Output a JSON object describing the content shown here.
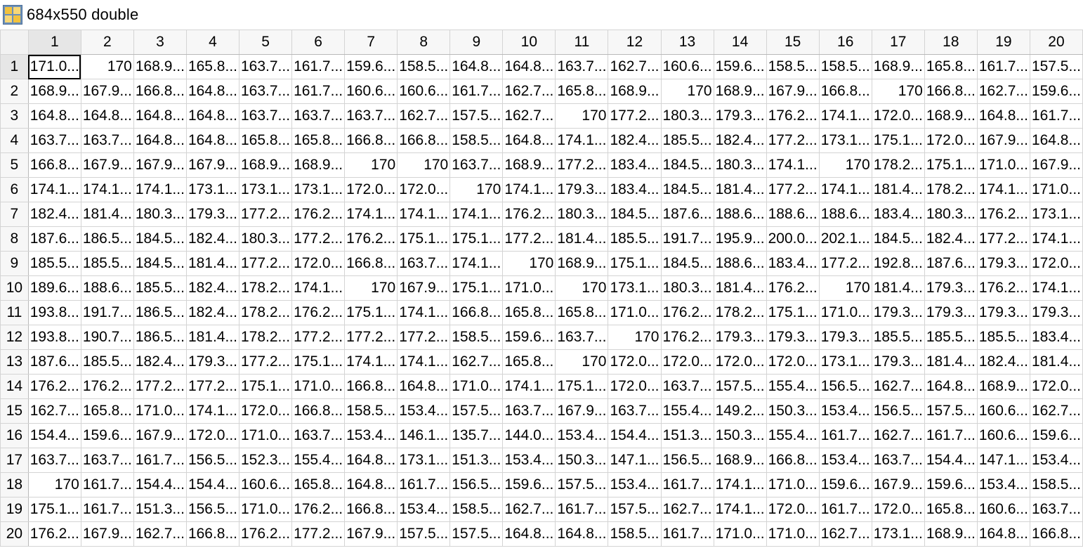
{
  "window": {
    "title": "684x550 double",
    "icon": "variable-grid-icon"
  },
  "columns": [
    "1",
    "2",
    "3",
    "4",
    "5",
    "6",
    "7",
    "8",
    "9",
    "10",
    "11",
    "12",
    "13",
    "14",
    "15",
    "16",
    "17",
    "18",
    "19",
    "20"
  ],
  "rows": [
    {
      "label": "1",
      "cells": [
        "171.0...",
        "170",
        "168.9...",
        "165.8...",
        "163.7...",
        "161.7...",
        "159.6...",
        "158.5...",
        "164.8...",
        "164.8...",
        "163.7...",
        "162.7...",
        "160.6...",
        "159.6...",
        "158.5...",
        "158.5...",
        "168.9...",
        "165.8...",
        "161.7...",
        "157.5..."
      ]
    },
    {
      "label": "2",
      "cells": [
        "168.9...",
        "167.9...",
        "166.8...",
        "164.8...",
        "163.7...",
        "161.7...",
        "160.6...",
        "160.6...",
        "161.7...",
        "162.7...",
        "165.8...",
        "168.9...",
        "170",
        "168.9...",
        "167.9...",
        "166.8...",
        "170",
        "166.8...",
        "162.7...",
        "159.6..."
      ]
    },
    {
      "label": "3",
      "cells": [
        "164.8...",
        "164.8...",
        "164.8...",
        "164.8...",
        "163.7...",
        "163.7...",
        "163.7...",
        "162.7...",
        "157.5...",
        "162.7...",
        "170",
        "177.2...",
        "180.3...",
        "179.3...",
        "176.2...",
        "174.1...",
        "172.0...",
        "168.9...",
        "164.8...",
        "161.7..."
      ]
    },
    {
      "label": "4",
      "cells": [
        "163.7...",
        "163.7...",
        "164.8...",
        "164.8...",
        "165.8...",
        "165.8...",
        "166.8...",
        "166.8...",
        "158.5...",
        "164.8...",
        "174.1...",
        "182.4...",
        "185.5...",
        "182.4...",
        "177.2...",
        "173.1...",
        "175.1...",
        "172.0...",
        "167.9...",
        "164.8..."
      ]
    },
    {
      "label": "5",
      "cells": [
        "166.8...",
        "167.9...",
        "167.9...",
        "167.9...",
        "168.9...",
        "168.9...",
        "170",
        "170",
        "163.7...",
        "168.9...",
        "177.2...",
        "183.4...",
        "184.5...",
        "180.3...",
        "174.1...",
        "170",
        "178.2...",
        "175.1...",
        "171.0...",
        "167.9..."
      ]
    },
    {
      "label": "6",
      "cells": [
        "174.1...",
        "174.1...",
        "174.1...",
        "173.1...",
        "173.1...",
        "173.1...",
        "172.0...",
        "172.0...",
        "170",
        "174.1...",
        "179.3...",
        "183.4...",
        "184.5...",
        "181.4...",
        "177.2...",
        "174.1...",
        "181.4...",
        "178.2...",
        "174.1...",
        "171.0..."
      ]
    },
    {
      "label": "7",
      "cells": [
        "182.4...",
        "181.4...",
        "180.3...",
        "179.3...",
        "177.2...",
        "176.2...",
        "174.1...",
        "174.1...",
        "174.1...",
        "176.2...",
        "180.3...",
        "184.5...",
        "187.6...",
        "188.6...",
        "188.6...",
        "188.6...",
        "183.4...",
        "180.3...",
        "176.2...",
        "173.1..."
      ]
    },
    {
      "label": "8",
      "cells": [
        "187.6...",
        "186.5...",
        "184.5...",
        "182.4...",
        "180.3...",
        "177.2...",
        "176.2...",
        "175.1...",
        "175.1...",
        "177.2...",
        "181.4...",
        "185.5...",
        "191.7...",
        "195.9...",
        "200.0...",
        "202.1...",
        "184.5...",
        "182.4...",
        "177.2...",
        "174.1..."
      ]
    },
    {
      "label": "9",
      "cells": [
        "185.5...",
        "185.5...",
        "184.5...",
        "181.4...",
        "177.2...",
        "172.0...",
        "166.8...",
        "163.7...",
        "174.1...",
        "170",
        "168.9...",
        "175.1...",
        "184.5...",
        "188.6...",
        "183.4...",
        "177.2...",
        "192.8...",
        "187.6...",
        "179.3...",
        "172.0..."
      ]
    },
    {
      "label": "10",
      "cells": [
        "189.6...",
        "188.6...",
        "185.5...",
        "182.4...",
        "178.2...",
        "174.1...",
        "170",
        "167.9...",
        "175.1...",
        "171.0...",
        "170",
        "173.1...",
        "180.3...",
        "181.4...",
        "176.2...",
        "170",
        "181.4...",
        "179.3...",
        "176.2...",
        "174.1..."
      ]
    },
    {
      "label": "11",
      "cells": [
        "193.8...",
        "191.7...",
        "186.5...",
        "182.4...",
        "178.2...",
        "176.2...",
        "175.1...",
        "174.1...",
        "166.8...",
        "165.8...",
        "165.8...",
        "171.0...",
        "176.2...",
        "178.2...",
        "175.1...",
        "171.0...",
        "179.3...",
        "179.3...",
        "179.3...",
        "179.3..."
      ]
    },
    {
      "label": "12",
      "cells": [
        "193.8...",
        "190.7...",
        "186.5...",
        "181.4...",
        "178.2...",
        "177.2...",
        "177.2...",
        "177.2...",
        "158.5...",
        "159.6...",
        "163.7...",
        "170",
        "176.2...",
        "179.3...",
        "179.3...",
        "179.3...",
        "185.5...",
        "185.5...",
        "185.5...",
        "183.4..."
      ]
    },
    {
      "label": "13",
      "cells": [
        "187.6...",
        "185.5...",
        "182.4...",
        "179.3...",
        "177.2...",
        "175.1...",
        "174.1...",
        "174.1...",
        "162.7...",
        "165.8...",
        "170",
        "172.0...",
        "172.0...",
        "172.0...",
        "172.0...",
        "173.1...",
        "179.3...",
        "181.4...",
        "182.4...",
        "181.4..."
      ]
    },
    {
      "label": "14",
      "cells": [
        "176.2...",
        "176.2...",
        "177.2...",
        "177.2...",
        "175.1...",
        "171.0...",
        "166.8...",
        "164.8...",
        "171.0...",
        "174.1...",
        "175.1...",
        "172.0...",
        "163.7...",
        "157.5...",
        "155.4...",
        "156.5...",
        "162.7...",
        "164.8...",
        "168.9...",
        "172.0..."
      ]
    },
    {
      "label": "15",
      "cells": [
        "162.7...",
        "165.8...",
        "171.0...",
        "174.1...",
        "172.0...",
        "166.8...",
        "158.5...",
        "153.4...",
        "157.5...",
        "163.7...",
        "167.9...",
        "163.7...",
        "155.4...",
        "149.2...",
        "150.3...",
        "153.4...",
        "156.5...",
        "157.5...",
        "160.6...",
        "162.7..."
      ]
    },
    {
      "label": "16",
      "cells": [
        "154.4...",
        "159.6...",
        "167.9...",
        "172.0...",
        "171.0...",
        "163.7...",
        "153.4...",
        "146.1...",
        "135.7...",
        "144.0...",
        "153.4...",
        "154.4...",
        "151.3...",
        "150.3...",
        "155.4...",
        "161.7...",
        "162.7...",
        "161.7...",
        "160.6...",
        "159.6..."
      ]
    },
    {
      "label": "17",
      "cells": [
        "163.7...",
        "163.7...",
        "161.7...",
        "156.5...",
        "152.3...",
        "155.4...",
        "164.8...",
        "173.1...",
        "151.3...",
        "153.4...",
        "150.3...",
        "147.1...",
        "156.5...",
        "168.9...",
        "166.8...",
        "153.4...",
        "163.7...",
        "154.4...",
        "147.1...",
        "153.4..."
      ]
    },
    {
      "label": "18",
      "cells": [
        "170",
        "161.7...",
        "154.4...",
        "154.4...",
        "160.6...",
        "165.8...",
        "164.8...",
        "161.7...",
        "156.5...",
        "159.6...",
        "157.5...",
        "153.4...",
        "161.7...",
        "174.1...",
        "171.0...",
        "159.6...",
        "167.9...",
        "159.6...",
        "153.4...",
        "158.5..."
      ]
    },
    {
      "label": "19",
      "cells": [
        "175.1...",
        "161.7...",
        "151.3...",
        "156.5...",
        "171.0...",
        "176.2...",
        "166.8...",
        "153.4...",
        "158.5...",
        "162.7...",
        "161.7...",
        "157.5...",
        "162.7...",
        "174.1...",
        "172.0...",
        "161.7...",
        "172.0...",
        "165.8...",
        "160.6...",
        "163.7..."
      ]
    },
    {
      "label": "20",
      "cells": [
        "176.2...",
        "167.9...",
        "162.7...",
        "166.8...",
        "176.2...",
        "177.2...",
        "167.9...",
        "157.5...",
        "157.5...",
        "164.8...",
        "164.8...",
        "158.5...",
        "161.7...",
        "171.0...",
        "171.0...",
        "162.7...",
        "173.1...",
        "168.9...",
        "164.8...",
        "166.8..."
      ]
    }
  ],
  "selection": {
    "row": 0,
    "col": 0
  }
}
